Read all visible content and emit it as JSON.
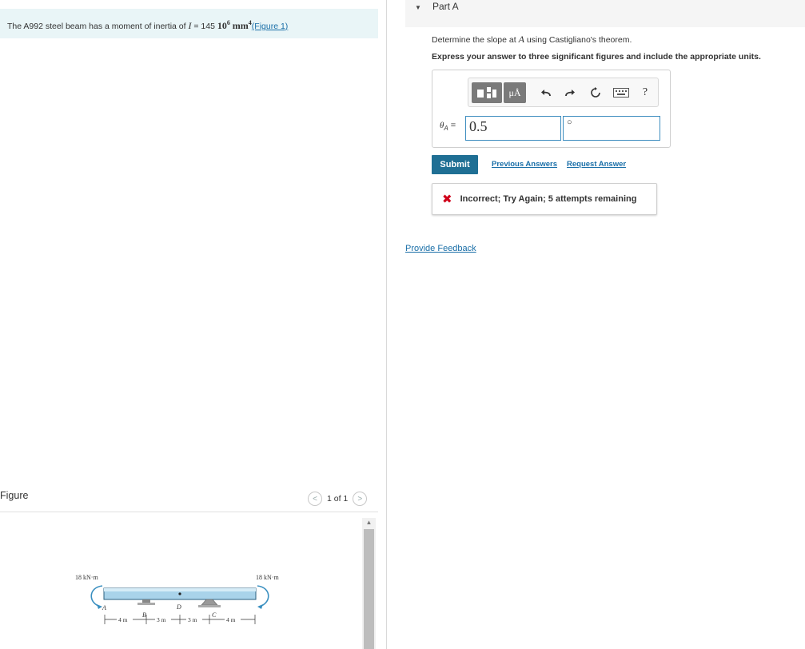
{
  "problem": {
    "text_before": "The A992 steel beam has a moment of inertia of ",
    "var_I": "I",
    "equals": " = 145 ",
    "power_base": "10",
    "power_exp": "6",
    "unit_base": "mm",
    "unit_exp": "4",
    "figure_link": "(Figure 1)"
  },
  "figure": {
    "title": "Figure",
    "pager_text": "1 of 1",
    "prev_glyph": "<",
    "next_glyph": ">",
    "labels": {
      "moment_left": "18 kN·m",
      "moment_right": "18 kN·m",
      "point_a": "A",
      "point_b": "B",
      "point_c": "C",
      "point_d": "D",
      "dim1": "4 m",
      "dim2": "3 m",
      "dim3": "3 m",
      "dim4": "4 m"
    }
  },
  "part": {
    "title": "Part A",
    "question_prefix": "Determine the slope at ",
    "question_var": "A",
    "question_suffix": " using Castigliano's theorem.",
    "instruction": "Express your answer to three significant figures and include the appropriate units."
  },
  "answer": {
    "toolbar": {
      "templates_icon": "templates-icon",
      "units_label": "μÅ",
      "undo_icon": "undo-icon",
      "redo_icon": "redo-icon",
      "reset_icon": "reset-icon",
      "keyboard_icon": "keyboard-icon",
      "help_label": "?"
    },
    "theta_var": "θ",
    "theta_sub": "A",
    "equals": " = ",
    "value": "0.5",
    "unit_value": "○"
  },
  "actions": {
    "submit_label": "Submit",
    "previous_answers": "Previous Answers",
    "request_answer": "Request Answer"
  },
  "feedback": {
    "message": "Incorrect; Try Again; 5 attempts remaining",
    "icon": "x-icon",
    "color": "#d0021b"
  },
  "provide_feedback": "Provide Feedback",
  "colors": {
    "accent": "#1f6f94",
    "link": "#1a6fa8",
    "problem_bg": "#e9f5f7"
  }
}
